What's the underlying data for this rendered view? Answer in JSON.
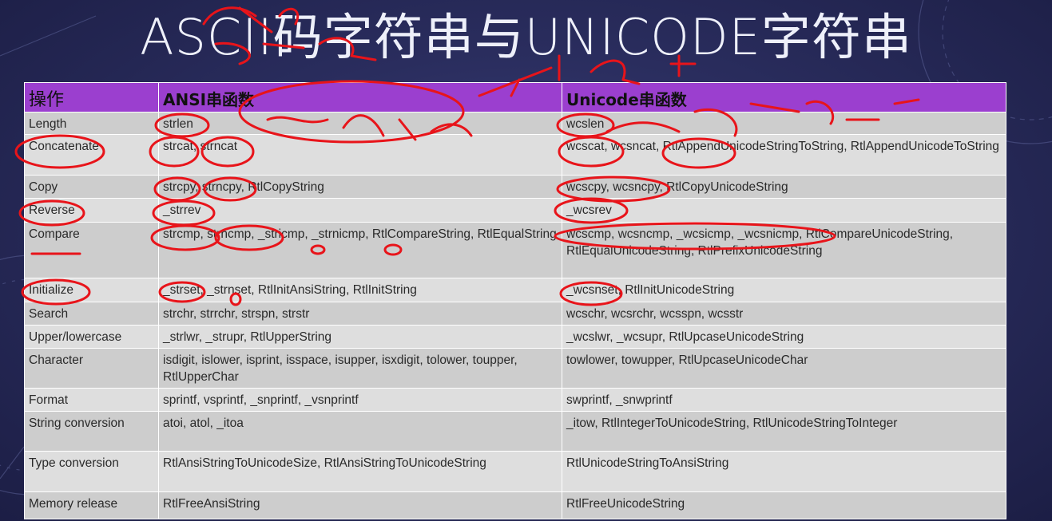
{
  "slide": {
    "title": "ASCII码字符串与UNICODE字符串"
  },
  "table": {
    "headers": [
      "操作",
      "ANSI串函数",
      "Unicode串函数"
    ],
    "rows": [
      {
        "op": "Length",
        "ansi": "strlen",
        "unicode": "wcslen"
      },
      {
        "op": "Concatenate",
        "ansi": "strcat, strncat",
        "unicode": "wcscat, wcsncat, RtlAppendUnicodeStringToString, RtlAppendUnicodeToString"
      },
      {
        "op": "Copy",
        "ansi": "strcpy, strncpy, RtlCopyString",
        "unicode": "wcscpy, wcsncpy, RtlCopyUnicodeString"
      },
      {
        "op": "Reverse",
        "ansi": "_strrev",
        "unicode": "_wcsrev"
      },
      {
        "op": "Compare",
        "ansi": "strcmp, strncmp, _stricmp, _strnicmp, RtlCompareString, RtlEqualString",
        "unicode": "wcscmp, wcsncmp, _wcsicmp, _wcsnicmp, RtlCompareUnicodeString, RtlEqualUnicodeString, RtlPrefixUnicodeString"
      },
      {
        "op": "Initialize",
        "ansi": "_strset, _strnset, RtlInitAnsiString, RtlInitString",
        "unicode": "_wcsnset, RtlInitUnicodeString"
      },
      {
        "op": "Search",
        "ansi": "strchr, strrchr, strspn, strstr",
        "unicode": "wcschr, wcsrchr, wcsspn, wcsstr"
      },
      {
        "op": "Upper/lowercase",
        "ansi": "_strlwr, _strupr, RtlUpperString",
        "unicode": "_wcslwr, _wcsupr, RtlUpcaseUnicodeString"
      },
      {
        "op": "Character",
        "ansi": "isdigit, islower, isprint, isspace, isupper, isxdigit, tolower, toupper, RtlUpperChar",
        "unicode": "towlower, towupper, RtlUpcaseUnicodeChar"
      },
      {
        "op": "Format",
        "ansi": "sprintf, vsprintf, _snprintf, _vsnprintf",
        "unicode": "swprintf, _snwprintf"
      },
      {
        "op": "String conversion",
        "ansi": "atoi, atol, _itoa",
        "unicode": "_itow, RtlIntegerToUnicodeString, RtlUnicodeStringToInteger"
      },
      {
        "op": "Type conversion",
        "ansi": "RtlAnsiStringToUnicodeSize, RtlAnsiStringToUnicodeString",
        "unicode": "RtlUnicodeStringToAnsiString"
      },
      {
        "op": "Memory release",
        "ansi": "RtlFreeAnsiString",
        "unicode": "RtlFreeUnicodeString"
      }
    ]
  },
  "colors": {
    "header_bg": "#9b3fcf",
    "row_bg": "#cdcdcd",
    "row_alt_bg": "#dedede",
    "annotation": "#e8141a",
    "background": "#2a2d5e"
  }
}
